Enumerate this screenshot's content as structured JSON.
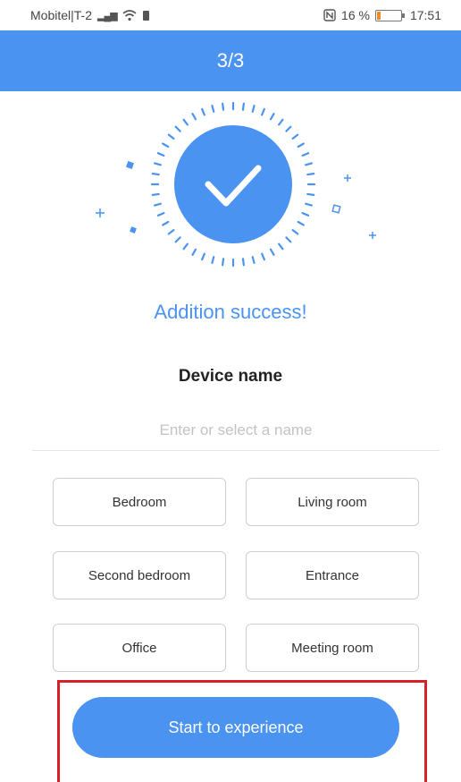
{
  "status_bar": {
    "carrier": "Mobitel|T-2",
    "battery": "16 %",
    "time": "17:51",
    "battery_color": "#f08a24"
  },
  "header": {
    "step": "3/3"
  },
  "success": {
    "message": "Addition success!"
  },
  "device": {
    "title": "Device name",
    "placeholder": "Enter or select a name",
    "value": ""
  },
  "names": [
    "Bedroom",
    "Living room",
    "Second bedroom",
    "Entrance",
    "Office",
    "Meeting room"
  ],
  "actions": {
    "start_label": "Start to experience"
  },
  "colors": {
    "accent": "#4a93f1",
    "highlight": "#d6202a"
  }
}
